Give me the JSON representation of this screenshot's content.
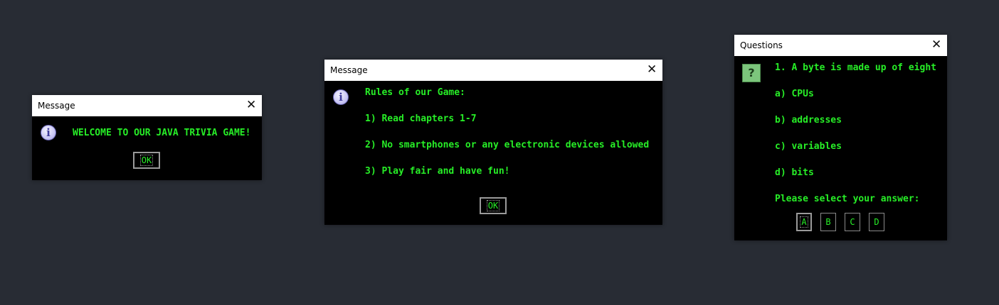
{
  "dialogs": {
    "welcome": {
      "title": "Message",
      "close_glyph": "✕",
      "icon": "info-icon",
      "message": "WELCOME TO OUR JAVA TRIVIA GAME!",
      "ok_label": "OK"
    },
    "rules": {
      "title": "Message",
      "close_glyph": "✕",
      "icon": "info-icon",
      "lines": [
        "Rules of our Game:",
        "1) Read chapters 1-7",
        "2) No smartphones or any electronic devices allowed",
        "3) Play fair and have fun!"
      ],
      "ok_label": "OK"
    },
    "questions": {
      "title": "Questions",
      "close_glyph": "✕",
      "icon": "question-icon",
      "question": "1. A byte is made up of eight",
      "options": [
        "a) CPUs",
        "b) addresses",
        "c) variables",
        "d) bits"
      ],
      "prompt": "Please select your answer:",
      "buttons": [
        "A",
        "B",
        "C",
        "D"
      ]
    }
  },
  "colors": {
    "background": "#282c34",
    "dialog_body": "#000000",
    "text_green": "#27ee27",
    "titlebar": "#ffffff"
  }
}
